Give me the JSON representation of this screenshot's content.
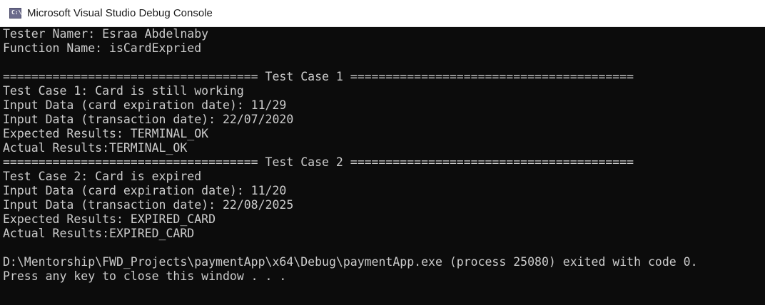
{
  "window": {
    "title": "Microsoft Visual Studio Debug Console",
    "icon": "console-app-icon",
    "icon_glyph": "C:\\"
  },
  "console": {
    "lines": [
      "Tester Namer: Esraa Abdelnaby",
      "Function Name: isCardExpried",
      "",
      "==================================== Test Case 1 ========================================",
      "Test Case 1: Card is still working",
      "Input Data (card expiration date): 11/29",
      "Input Data (transaction date): 22/07/2020",
      "Expected Results: TERMINAL_OK",
      "Actual Results:TERMINAL_OK",
      "==================================== Test Case 2 ========================================",
      "Test Case 2: Card is expired",
      "Input Data (card expiration date): 11/20",
      "Input Data (transaction date): 22/08/2025",
      "Expected Results: EXPIRED_CARD",
      "Actual Results:EXPIRED_CARD",
      "",
      "D:\\Mentorship\\FWD_Projects\\paymentApp\\x64\\Debug\\paymentApp.exe (process 25080) exited with code 0.",
      "Press any key to close this window . . ."
    ]
  },
  "colors": {
    "console_background": "#0c0c0c",
    "console_text": "#cccccc",
    "titlebar_background": "#ffffff"
  }
}
